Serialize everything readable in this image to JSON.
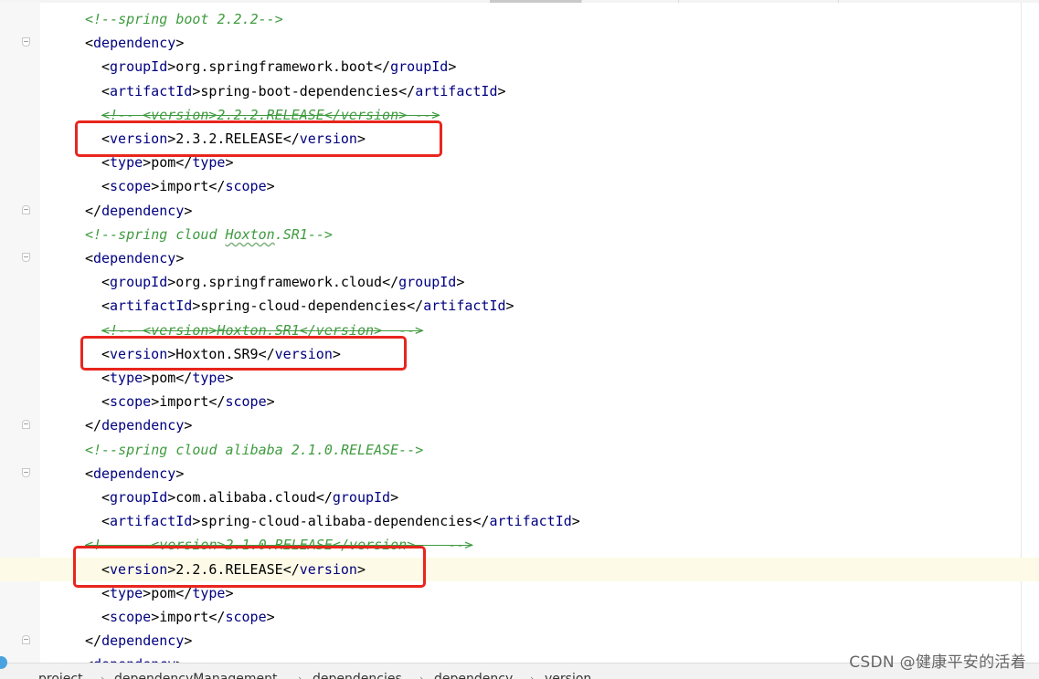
{
  "editor": {
    "lines": [
      {
        "indent": 0,
        "kind": "comment",
        "text": "<!--spring boot 2.2.2-->"
      },
      {
        "indent": 0,
        "kind": "open",
        "tag": "dependency",
        "fold": "open"
      },
      {
        "indent": 1,
        "kind": "element",
        "tag": "groupId",
        "value": "org.springframework.boot"
      },
      {
        "indent": 1,
        "kind": "element",
        "tag": "artifactId",
        "value": "spring-boot-dependencies"
      },
      {
        "indent": 1,
        "kind": "comment",
        "text": "<!-- <version>2.2.2.RELEASE</version> -->",
        "strike": true
      },
      {
        "indent": 1,
        "kind": "element",
        "tag": "version",
        "value": "2.3.2.RELEASE",
        "highlighted": true
      },
      {
        "indent": 1,
        "kind": "element",
        "tag": "type",
        "value": "pom"
      },
      {
        "indent": 1,
        "kind": "element",
        "tag": "scope",
        "value": "import"
      },
      {
        "indent": 0,
        "kind": "close",
        "tag": "dependency",
        "fold": "close"
      },
      {
        "indent": 0,
        "kind": "comment",
        "text": "<!--spring cloud Hoxton.SR1-->",
        "squiggle": "Hoxton"
      },
      {
        "indent": 0,
        "kind": "open",
        "tag": "dependency",
        "fold": "open"
      },
      {
        "indent": 1,
        "kind": "element",
        "tag": "groupId",
        "value": "org.springframework.cloud"
      },
      {
        "indent": 1,
        "kind": "element",
        "tag": "artifactId",
        "value": "spring-cloud-dependencies"
      },
      {
        "indent": 1,
        "kind": "comment",
        "text": "<!-- <version>Hoxton.SR1</version>  -->",
        "strike": true
      },
      {
        "indent": 1,
        "kind": "element",
        "tag": "version",
        "value": "Hoxton.SR9",
        "highlighted": true
      },
      {
        "indent": 1,
        "kind": "element",
        "tag": "type",
        "value": "pom"
      },
      {
        "indent": 1,
        "kind": "element",
        "tag": "scope",
        "value": "import"
      },
      {
        "indent": 0,
        "kind": "close",
        "tag": "dependency",
        "fold": "close"
      },
      {
        "indent": 0,
        "kind": "comment",
        "text": "<!--spring cloud alibaba 2.1.0.RELEASE-->"
      },
      {
        "indent": 0,
        "kind": "open",
        "tag": "dependency",
        "fold": "open"
      },
      {
        "indent": 1,
        "kind": "element",
        "tag": "groupId",
        "value": "com.alibaba.cloud"
      },
      {
        "indent": 1,
        "kind": "element",
        "tag": "artifactId",
        "value": "spring-cloud-alibaba-dependencies"
      },
      {
        "indent": 0,
        "kind": "comment",
        "text": "<!--    <version>2.1.0.RELEASE</version>    -->",
        "strike": true
      },
      {
        "indent": 1,
        "kind": "element",
        "tag": "version",
        "value": "2.2.6.RELEASE",
        "highlighted": true,
        "current": true
      },
      {
        "indent": 1,
        "kind": "element",
        "tag": "type",
        "value": "pom"
      },
      {
        "indent": 1,
        "kind": "element",
        "tag": "scope",
        "value": "import"
      },
      {
        "indent": 0,
        "kind": "close",
        "tag": "dependency",
        "fold": "close"
      },
      {
        "indent": 0,
        "kind": "open",
        "tag": "dependency",
        "partial": true
      }
    ]
  },
  "breadcrumb": [
    "project",
    "dependencyManagement",
    "dependencies",
    "dependency",
    "version"
  ],
  "watermark": "CSDN @健康平安的活着",
  "colors": {
    "tag": "#000080",
    "comment": "#3f9b3f",
    "highlight_border": "#e8261e",
    "current_line": "#fdfbe7",
    "gutter": "#f7f7f7"
  },
  "icons": {
    "fold_marker": "fold-marker-icon",
    "status_indicator": "status-indicator-icon"
  }
}
